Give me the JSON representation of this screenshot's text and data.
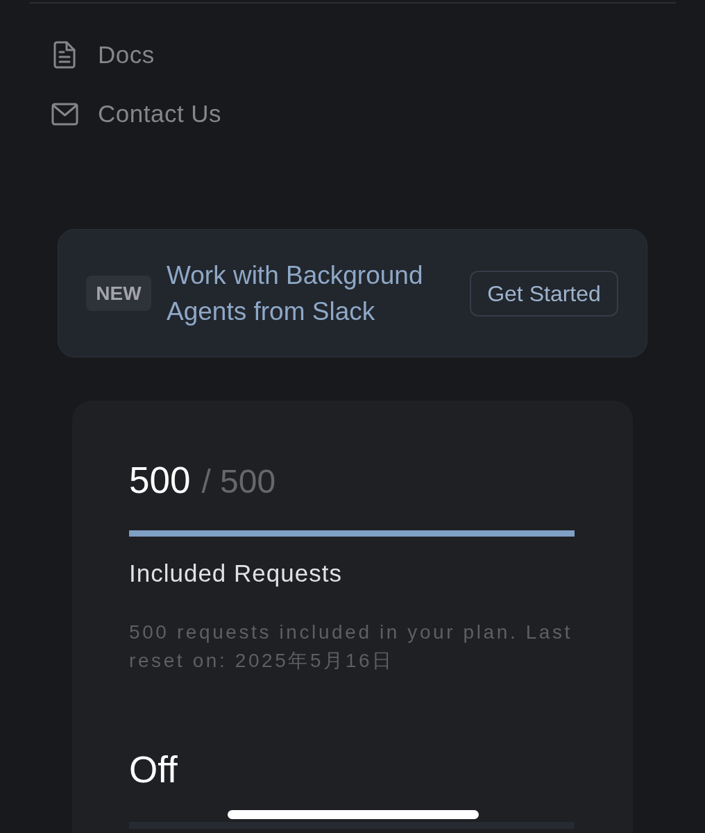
{
  "nav": {
    "items": [
      {
        "kind": "document",
        "label": "Docs"
      },
      {
        "kind": "mail",
        "label": "Contact Us"
      }
    ]
  },
  "banner": {
    "badge": "NEW",
    "title": "Work with Background Agents from Slack",
    "button": "Get Started"
  },
  "usage": {
    "meters": [
      {
        "value": "500",
        "limit": "/ 500",
        "level": 1,
        "label": "Included Requests",
        "description": "500 requests included in your plan. Last reset on: 2025年5月16日"
      },
      {
        "value": "Off",
        "level": 0
      }
    ]
  }
}
